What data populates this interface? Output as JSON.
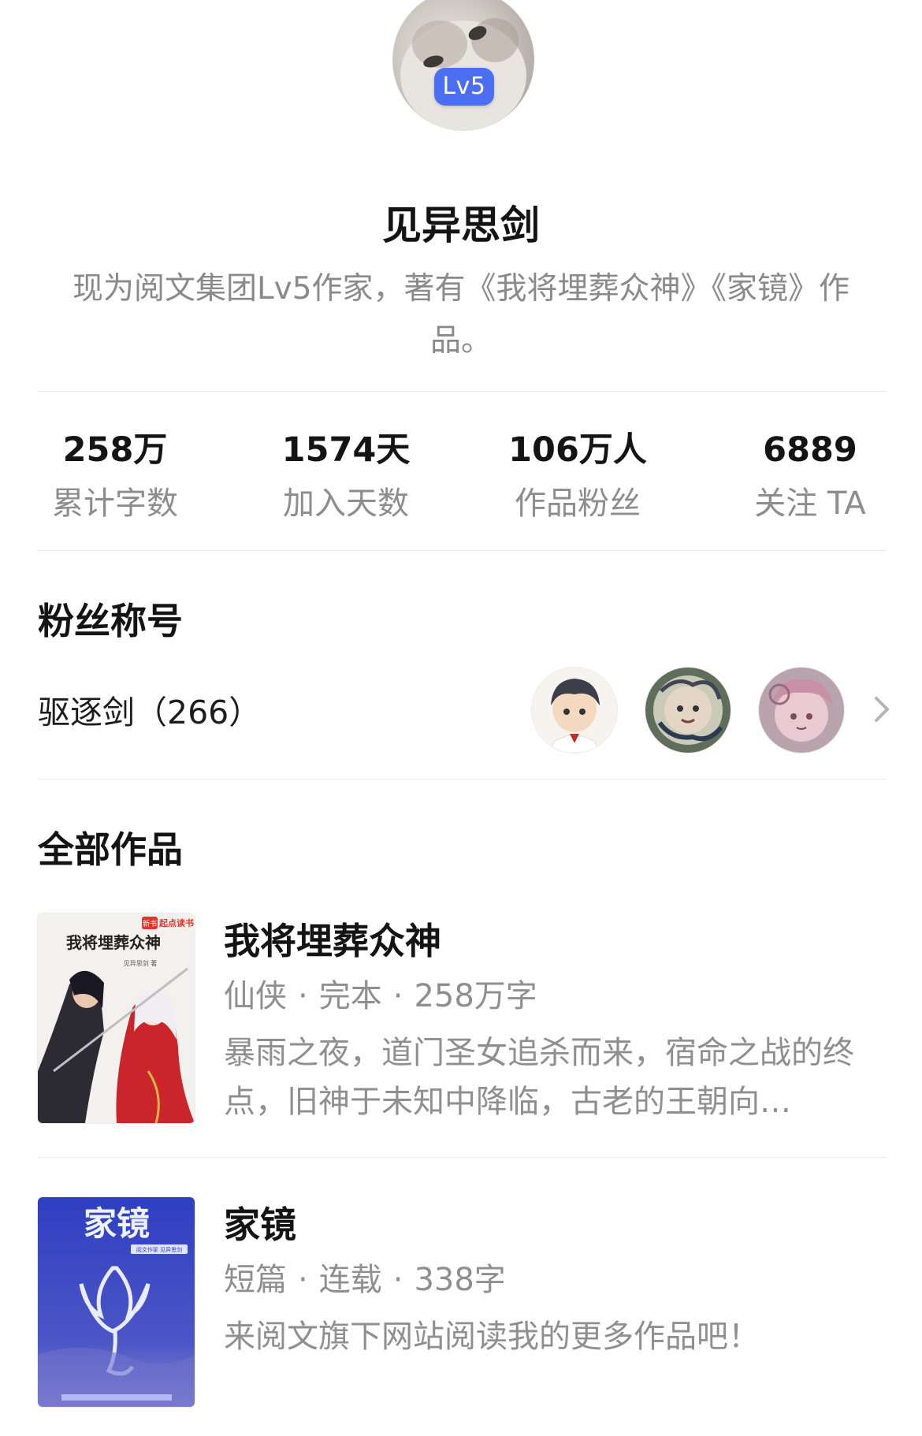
{
  "profile": {
    "level_badge": "Lv5",
    "name": "见异思剑",
    "bio": "现为阅文集团Lv5作家，著有《我将埋葬众神》《家镜》作品。"
  },
  "stats": [
    {
      "value": "258万",
      "label": "累计字数"
    },
    {
      "value": "1574天",
      "label": "加入天数"
    },
    {
      "value": "106万人",
      "label": "作品粉丝"
    },
    {
      "value": "6889",
      "label": "关注 TA"
    }
  ],
  "fan_section": {
    "title": "粉丝称号",
    "fan_title_name": "驱逐剑（266）",
    "fan_avatars": [
      "fan-avatar-boy",
      "fan-avatar-lion",
      "fan-avatar-pink"
    ],
    "chevron_icon": "chevron-right-icon"
  },
  "works_section": {
    "title": "全部作品",
    "works": [
      {
        "title": "我将埋葬众神",
        "genre": "仙侠",
        "status": "完本",
        "words": "258万字",
        "description": "暴雨之夜，道门圣女追杀而来，宿命之战的终点，旧神于未知中降临，古老的王朝向…",
        "cover": {
          "title": "我将埋葬众神",
          "publisher": "起点读书",
          "publisher_tag": "新书",
          "author": "见异思剑 著"
        }
      },
      {
        "title": "家镜",
        "genre": "短篇",
        "status": "连载",
        "words": "338字",
        "description": "来阅文旗下网站阅读我的更多作品吧！",
        "cover": {
          "title": "家镜",
          "subtitle": "阅文作家 见异思剑"
        }
      }
    ]
  },
  "colors": {
    "badge": "#4c6ef5",
    "primary_text": "#141414",
    "secondary_text": "#8f8f8f",
    "divider": "#ececec",
    "cover2_bg": "#3a3fc0"
  }
}
